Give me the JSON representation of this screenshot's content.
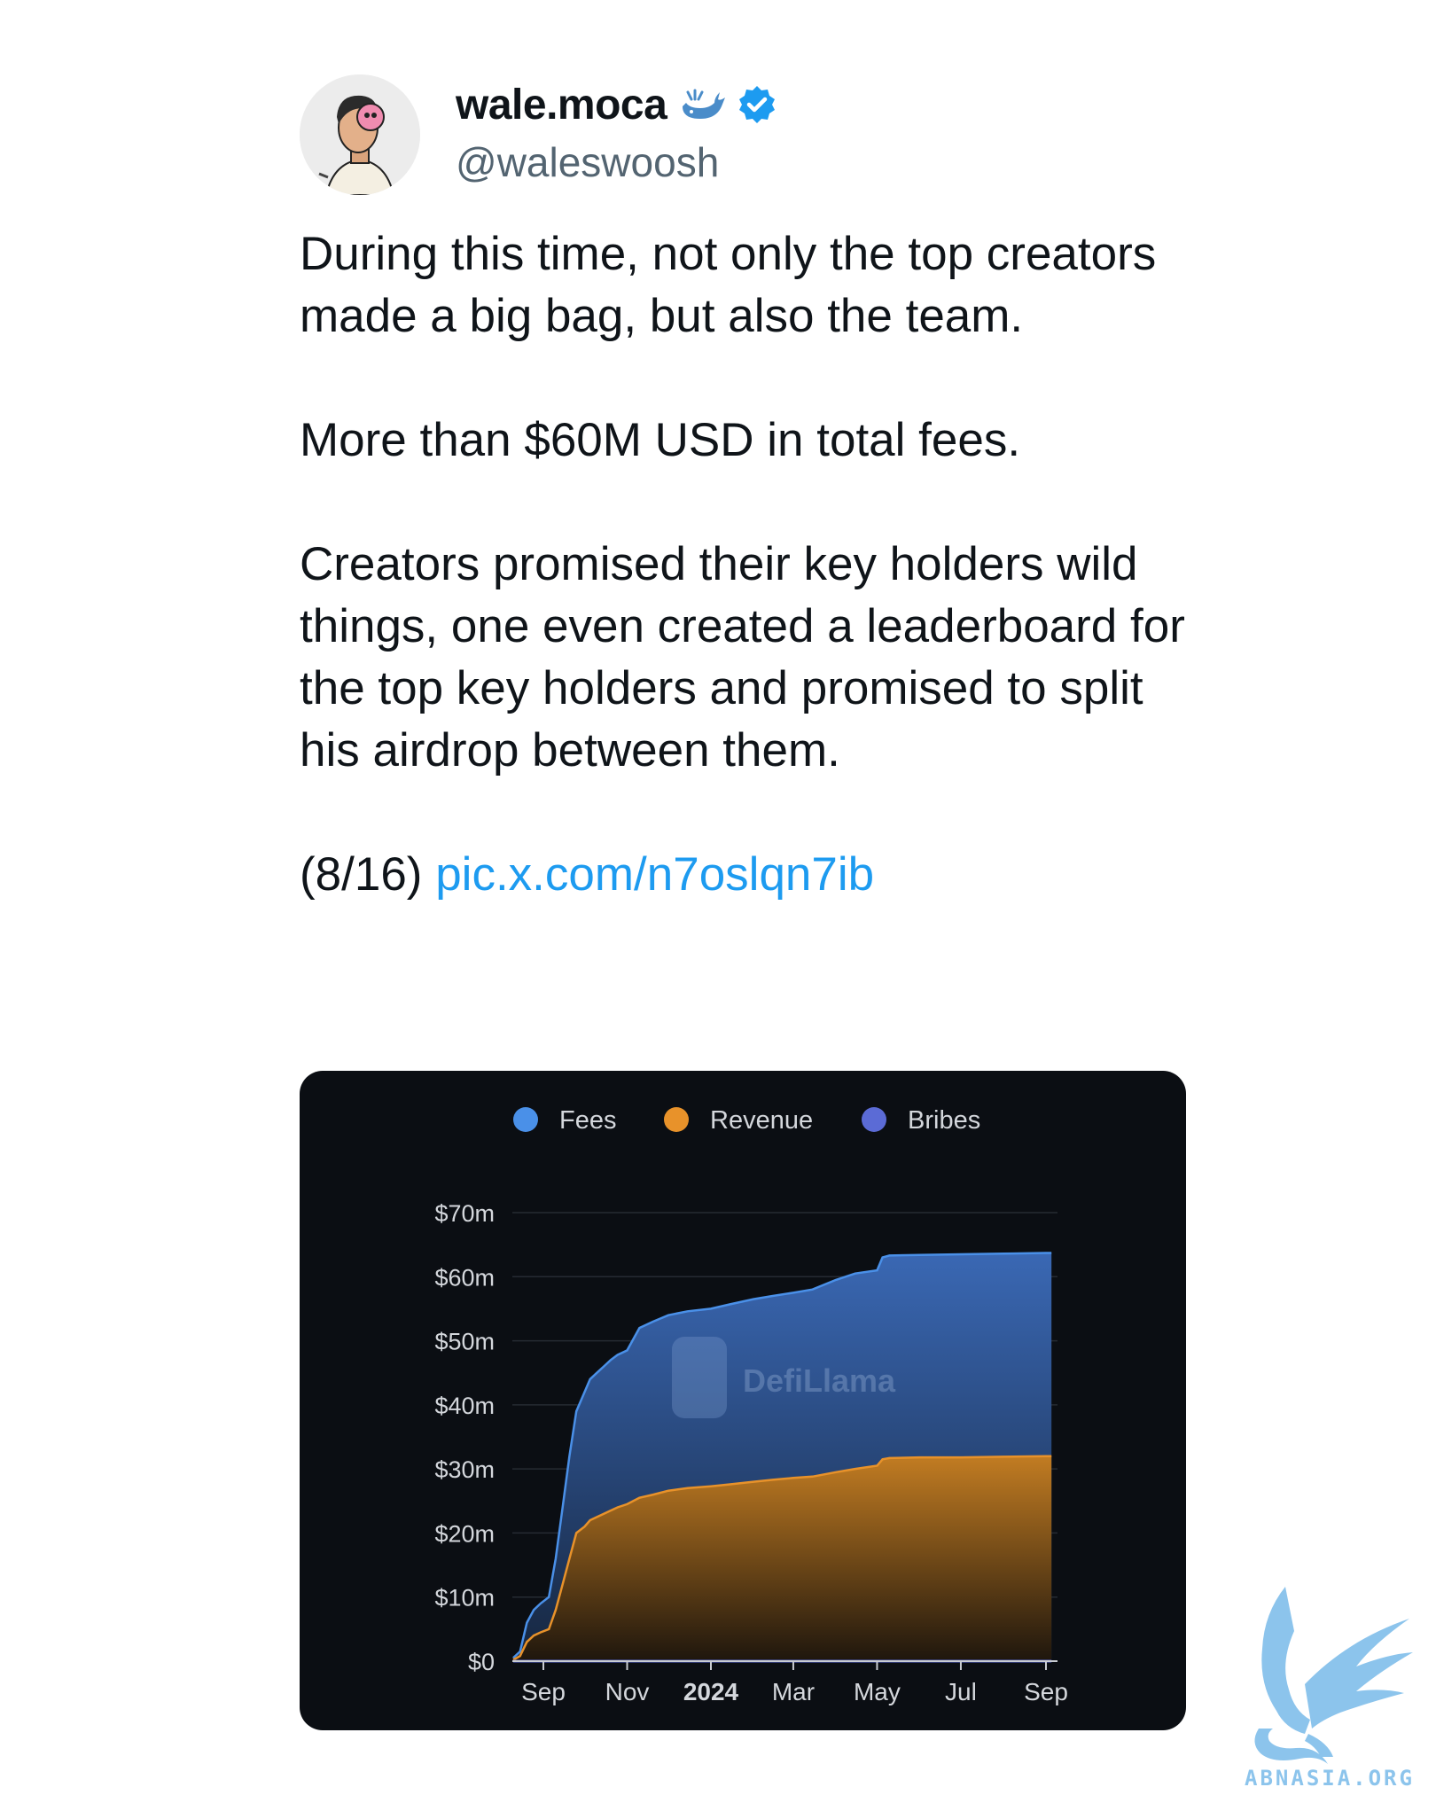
{
  "tweet": {
    "author_name": "wale.moca",
    "handle": "@waleswoosh",
    "paragraphs": [
      "During this time, not only the top creators made a big bag, but also the team.",
      "More than $60M USD in total fees.",
      "Creators promised their key holders wild things, one even created a leaderboard for the top key holders and promised to split his airdrop between them."
    ],
    "thread_position": "(8/16)",
    "link_text": "pic.x.com/n7oslqn7ib",
    "icons": [
      "avatar",
      "whale-icon",
      "verified-icon"
    ]
  },
  "chart_data": {
    "type": "area",
    "title": "",
    "watermark": "DefiLlama",
    "legend": [
      {
        "name": "Fees",
        "color": "#4a90e8"
      },
      {
        "name": "Revenue",
        "color": "#e8922a"
      },
      {
        "name": "Bribes",
        "color": "#5b6bd6"
      }
    ],
    "legend_position": "top-center",
    "x_ticks": [
      "Sep",
      "Nov",
      "2024",
      "Mar",
      "May",
      "Jul",
      "Sep"
    ],
    "y_ticks": [
      "$0",
      "$10m",
      "$20m",
      "$30m",
      "$40m",
      "$50m",
      "$60m",
      "$70m"
    ],
    "ylim": [
      0,
      70
    ],
    "y_unit": "$m",
    "grid": true,
    "x": [
      "2023-08-10",
      "2023-08-15",
      "2023-08-20",
      "2023-08-25",
      "2023-08-30",
      "2023-09-05",
      "2023-09-10",
      "2023-09-15",
      "2023-09-20",
      "2023-09-25",
      "2023-10-01",
      "2023-10-05",
      "2023-10-10",
      "2023-10-15",
      "2023-10-20",
      "2023-10-25",
      "2023-11-01",
      "2023-11-10",
      "2023-11-20",
      "2023-12-01",
      "2023-12-15",
      "2024-01-01",
      "2024-01-15",
      "2024-02-01",
      "2024-02-15",
      "2024-03-01",
      "2024-03-15",
      "2024-04-01",
      "2024-04-15",
      "2024-05-01",
      "2024-05-05",
      "2024-05-10",
      "2024-06-01",
      "2024-07-01",
      "2024-08-01",
      "2024-09-01",
      "2024-09-05"
    ],
    "series": [
      {
        "name": "Fees",
        "values": [
          0.5,
          1.5,
          6,
          8,
          9,
          10,
          16,
          24,
          32,
          39,
          42,
          44,
          45,
          46,
          47,
          47.8,
          48.5,
          52,
          53,
          54,
          54.6,
          55,
          55.7,
          56.5,
          57,
          57.5,
          58,
          59.5,
          60.5,
          61,
          63,
          63.3,
          63.4,
          63.5,
          63.6,
          63.7,
          63.7
        ]
      },
      {
        "name": "Revenue",
        "values": [
          0.2,
          0.8,
          3,
          4,
          4.5,
          5,
          8,
          12,
          16,
          20,
          21,
          22,
          22.5,
          23,
          23.5,
          24,
          24.5,
          25.5,
          26,
          26.6,
          27,
          27.3,
          27.6,
          28,
          28.3,
          28.6,
          28.8,
          29.5,
          30,
          30.5,
          31.5,
          31.7,
          31.8,
          31.8,
          31.9,
          32,
          32
        ]
      },
      {
        "name": "Bribes",
        "values": [
          0,
          0,
          0,
          0,
          0,
          0,
          0,
          0,
          0,
          0,
          0,
          0,
          0,
          0,
          0,
          0,
          0,
          0,
          0,
          0,
          0,
          0,
          0,
          0,
          0,
          0,
          0,
          0,
          0,
          0,
          0,
          0,
          0,
          0,
          0,
          0,
          0
        ]
      }
    ]
  },
  "watermark_logo": {
    "text": "ABNASIA.ORG",
    "color": "#7fbde8"
  }
}
